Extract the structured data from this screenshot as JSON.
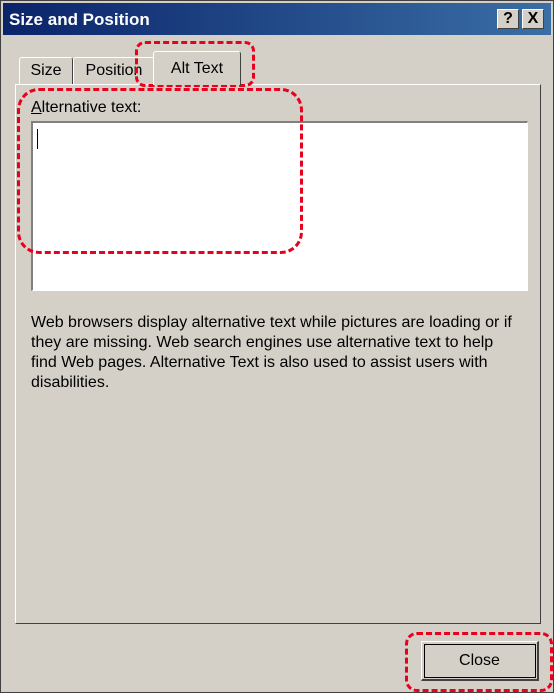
{
  "window": {
    "title": "Size and Position",
    "help_button": "?",
    "close_button": "X"
  },
  "tabs": [
    {
      "label": "Size",
      "selected": false
    },
    {
      "label": "Position",
      "selected": false
    },
    {
      "label": "Alt Text",
      "selected": true
    }
  ],
  "alt_text": {
    "label_mnemonic": "A",
    "label_rest": "lternative text:",
    "value": "",
    "description": "Web browsers display alternative text while pictures are loading or if they are missing.  Web search engines use alternative text to help find Web pages.  Alternative Text is also used to assist users with disabilities."
  },
  "footer": {
    "close_label": "Close"
  },
  "colors": {
    "dialog_bg": "#d4d0c8",
    "titlebar_start": "#0a246a",
    "titlebar_end": "#3a6ea5",
    "highlight": "#e8001c"
  }
}
